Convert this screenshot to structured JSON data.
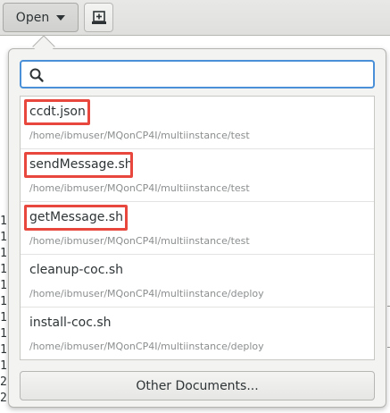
{
  "header": {
    "open_label": "Open",
    "open_icon": "chevron-down-icon",
    "new_doc_icon": "new-document-icon"
  },
  "background": {
    "gutter_digits": [
      "1",
      "1",
      "1",
      "1",
      "1",
      "1",
      "1",
      "1",
      "1",
      "1",
      "2",
      "2"
    ]
  },
  "popover": {
    "search": {
      "value": "",
      "placeholder": "",
      "icon": "search-icon"
    },
    "recent_files": [
      {
        "name": "ccdt.json",
        "path": "/home/ibmuser/MQonCP4I/multiinstance/test",
        "highlighted": true
      },
      {
        "name": "sendMessage.sh",
        "path": "/home/ibmuser/MQonCP4I/multiinstance/test",
        "highlighted": true
      },
      {
        "name": "getMessage.sh",
        "path": "/home/ibmuser/MQonCP4I/multiinstance/test",
        "highlighted": true
      },
      {
        "name": "cleanup-coc.sh",
        "path": "/home/ibmuser/MQonCP4I/multiinstance/deploy",
        "highlighted": false
      },
      {
        "name": "install-coc.sh",
        "path": "/home/ibmuser/MQonCP4I/multiinstance/deploy",
        "highlighted": false
      }
    ],
    "other_documents_label": "Other Documents..."
  },
  "colors": {
    "accent": "#4a90d9",
    "highlight_box": "#e8473e",
    "path_text": "#8b8e8f"
  }
}
